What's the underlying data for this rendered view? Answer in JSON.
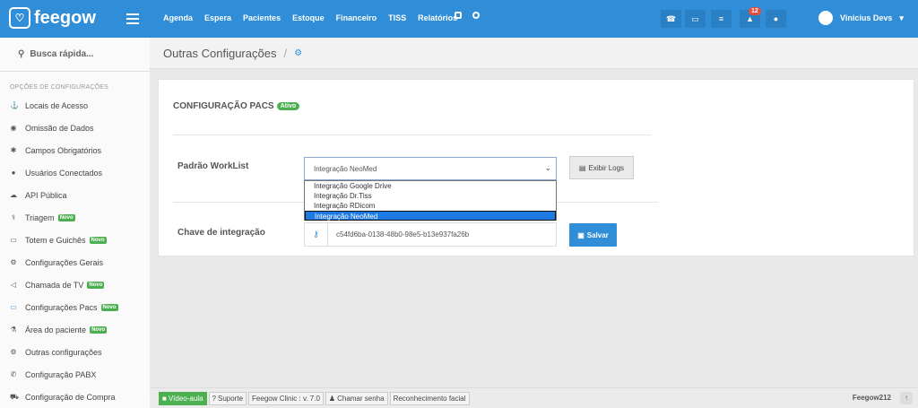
{
  "brand": {
    "name": "feegow"
  },
  "topnav": [
    "Agenda",
    "Espera",
    "Pacientes",
    "Estoque",
    "Financeiro",
    "TISS",
    "Relatórios"
  ],
  "header": {
    "notif_count": "12",
    "user_name": "Vinicius Devs"
  },
  "sidebar": {
    "search_label": "Busca rápida...",
    "section_title": "OPÇÕES DE CONFIGURAÇÕES",
    "items": [
      {
        "label": "Locais de Acesso",
        "icon": "anchor-icon"
      },
      {
        "label": "Omissão de Dados",
        "icon": "eye-icon"
      },
      {
        "label": "Campos Obrigatórios",
        "icon": "asterisk-icon"
      },
      {
        "label": "Usuários Conectados",
        "icon": "user-icon"
      },
      {
        "label": "API Pública",
        "icon": "cloud-icon"
      },
      {
        "label": "Triagem",
        "icon": "stethoscope-icon",
        "badge": "Novo"
      },
      {
        "label": "Totem e Guichês",
        "icon": "laptop-icon",
        "badge": "Novo"
      },
      {
        "label": "Configurações Gerais",
        "icon": "cogs-icon"
      },
      {
        "label": "Chamada de TV",
        "icon": "bullhorn-icon",
        "badge": "Novo"
      },
      {
        "label": "Configurações Pacs",
        "icon": "laptop-icon",
        "badge": "Novo"
      },
      {
        "label": "Área do paciente",
        "icon": "flask-icon",
        "badge": "Novo"
      },
      {
        "label": "Outras configurações",
        "icon": "cogs-icon"
      },
      {
        "label": "Configuração PABX",
        "icon": "phone-icon"
      },
      {
        "label": "Configuração de Compra",
        "icon": "cart-icon"
      }
    ]
  },
  "breadcrumb": {
    "title": "Outras Configurações",
    "separator": "/"
  },
  "panel": {
    "title": "CONFIGURAÇÃO PACS",
    "status_badge": "Ativo",
    "worklist_label": "Padrão WorkList",
    "worklist_selected": "Integração NeoMed",
    "worklist_options": [
      "Integração Google Drive",
      "Integração Dr.Tiss",
      "Integração RDicom",
      "Integração NeoMed"
    ],
    "logs_button": "Exibir Logs",
    "key_label": "Chave de integração",
    "key_value": "c54fd6ba-0138-48b0-98e5-b13e937fa26b",
    "save_button": "Salvar"
  },
  "footer": {
    "video_label": "Vídeo-aula",
    "support_label": "Suporte",
    "version_label": "Feegow Clinic : v. 7.0",
    "call_label": "Chamar senha",
    "face_label": "Reconhecimento facial",
    "username": "Feegow212"
  },
  "colors": {
    "primary": "#2f8ed7",
    "new_badge": "#4caf50",
    "notif": "#e74c3c"
  }
}
